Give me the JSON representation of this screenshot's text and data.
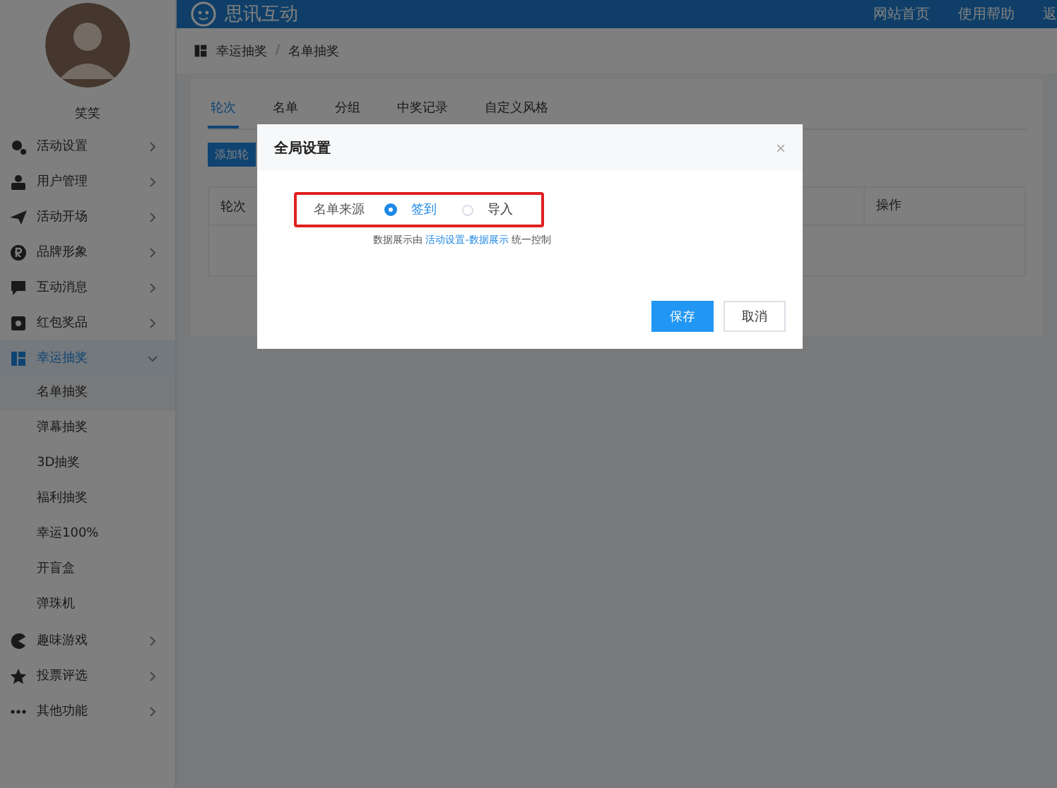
{
  "header": {
    "logo": "思讯互动",
    "links": [
      "网站首页",
      "使用帮助",
      "返"
    ]
  },
  "sidebar": {
    "user_name": "笑笑",
    "items": [
      {
        "label": "活动设置",
        "expanded": false,
        "selected": false
      },
      {
        "label": "用户管理",
        "expanded": false,
        "selected": false
      },
      {
        "label": "活动开场",
        "expanded": false,
        "selected": false
      },
      {
        "label": "品牌形象",
        "expanded": false,
        "selected": false
      },
      {
        "label": "互动消息",
        "expanded": false,
        "selected": false
      },
      {
        "label": "红包奖品",
        "expanded": false,
        "selected": false
      },
      {
        "label": "幸运抽奖",
        "expanded": true,
        "selected": true,
        "children": [
          {
            "label": "名单抽奖",
            "selected": true
          },
          {
            "label": "弹幕抽奖",
            "selected": false
          },
          {
            "label": "3D抽奖",
            "selected": false
          },
          {
            "label": "福利抽奖",
            "selected": false
          },
          {
            "label": "幸运100%",
            "selected": false
          },
          {
            "label": "开盲盒",
            "selected": false
          },
          {
            "label": "弹珠机",
            "selected": false
          }
        ]
      },
      {
        "label": "趣味游戏",
        "expanded": false,
        "selected": false
      },
      {
        "label": "投票评选",
        "expanded": false,
        "selected": false
      },
      {
        "label": "其他功能",
        "expanded": false,
        "selected": false
      }
    ]
  },
  "breadcrumb": {
    "items": [
      "幸运抽奖",
      "名单抽奖"
    ],
    "separator": "/"
  },
  "tabs": [
    {
      "label": "轮次",
      "selected": true
    },
    {
      "label": "名单",
      "selected": false
    },
    {
      "label": "分组",
      "selected": false
    },
    {
      "label": "中奖记录",
      "selected": false
    },
    {
      "label": "自定义风格",
      "selected": false
    }
  ],
  "add_button": "添加轮",
  "table": {
    "columns": [
      "轮次",
      "操作"
    ]
  },
  "dialog": {
    "title": "全局设置",
    "close": "×",
    "field_label": "名单来源",
    "options": [
      {
        "label": "签到",
        "selected": true
      },
      {
        "label": "导入",
        "selected": false
      }
    ],
    "hint_before": "数据展示由",
    "hint_link": "活动设置-数据展示",
    "hint_after": "统一控制",
    "buttons": [
      {
        "label": "保存",
        "kind": "primary"
      },
      {
        "label": "取消",
        "kind": "default"
      }
    ]
  }
}
